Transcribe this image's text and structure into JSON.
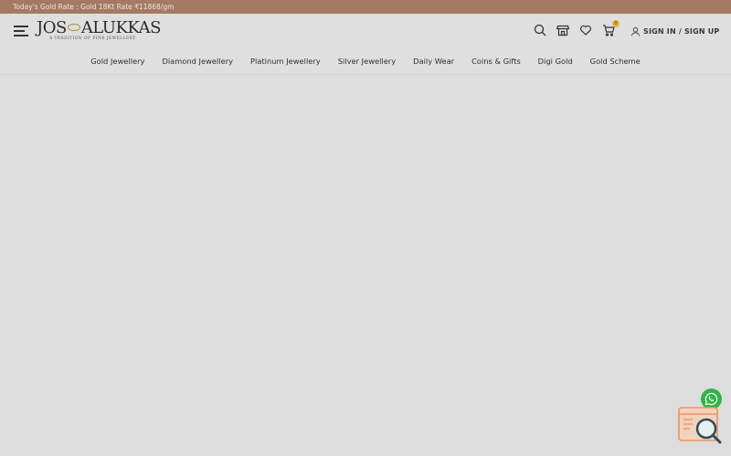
{
  "topbar": {
    "gold_rate": "Today's Gold Rate : Gold 18Kt Rate ₹11868/gm"
  },
  "brand": {
    "name_left": "JOS",
    "name_right": "ALUKKAS",
    "tagline": "A TRADITION OF FINE JEWELLERY"
  },
  "header": {
    "cart_count": "0",
    "signin_label": "SIGN IN / SIGN UP"
  },
  "nav": {
    "items": [
      {
        "label": "Gold Jewellery"
      },
      {
        "label": "Diamond Jewellery"
      },
      {
        "label": "Platinum Jewellery"
      },
      {
        "label": "Silver Jewellery"
      },
      {
        "label": "Daily Wear"
      },
      {
        "label": "Coins & Gifts"
      },
      {
        "label": "Digi Gold"
      },
      {
        "label": "Gold Scheme"
      }
    ]
  },
  "icons": {
    "menu": "hamburger-menu-icon",
    "search": "search-icon",
    "store": "store-icon",
    "wishlist": "heart-icon",
    "cart": "cart-icon",
    "user": "user-icon",
    "whatsapp": "whatsapp-icon",
    "chat": "chat-search-icon"
  },
  "colors": {
    "topbar": "#a47a64",
    "header": "#dfdfdf",
    "accent_gold": "#b28d3c",
    "whatsapp": "#2fb544",
    "chat_accent": "#e8955e",
    "chat_dark": "#2c4f5a"
  }
}
